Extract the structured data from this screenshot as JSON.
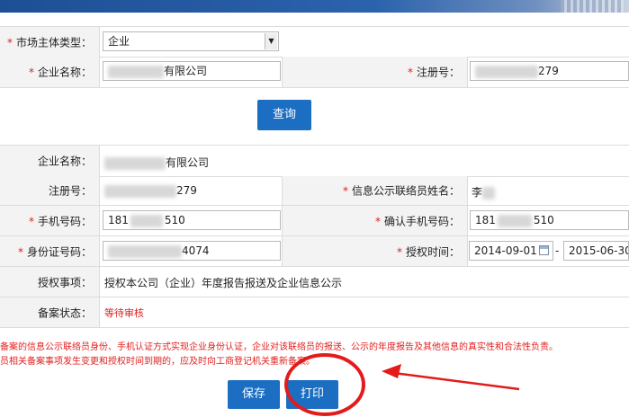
{
  "query_form": {
    "entity_type_label": "市场主体类型：",
    "entity_type_value": "企业",
    "company_name_label": "企业名称：",
    "company_name_value": "有限公司",
    "reg_no_label": "注册号：",
    "reg_no_value": "279",
    "query_button": "查询"
  },
  "result": {
    "company_name_label": "企业名称：",
    "company_name_value": "有限公司",
    "reg_no_label": "注册号：",
    "reg_no_value": "279",
    "contact_name_label": "信息公示联络员姓名：",
    "contact_name_value": "李",
    "phone_label": "手机号码：",
    "phone_prefix": "181",
    "phone_suffix": "510",
    "confirm_phone_label": "确认手机号码：",
    "confirm_phone_prefix": "181",
    "confirm_phone_suffix": "510",
    "id_label": "身份证号码：",
    "id_value": "4074",
    "auth_time_label": "授权时间：",
    "auth_start": "2014-09-01",
    "auth_sep": "-",
    "auth_end": "2015-06-30",
    "auth_matter_label": "授权事项：",
    "auth_matter_value": "授权本公司（企业）年度报告报送及企业信息公示",
    "filing_status_label": "备案状态：",
    "filing_status_value": "等待审核"
  },
  "notes": {
    "line1": "备案的信息公示联络员身份、手机认证方式实现企业身份认证，企业对该联络员的报送、公示的年度报告及其他信息的真实性和合法性负责。",
    "line2": "员相关备案事项发生变更和授权时间到期的，应及时向工商登记机关重新备案。"
  },
  "buttons": {
    "save": "保存",
    "print": "打印"
  },
  "required_mark": "*",
  "colors": {
    "accent": "#1b6ec2",
    "required": "#e02020",
    "annotation": "#e31b1b"
  }
}
